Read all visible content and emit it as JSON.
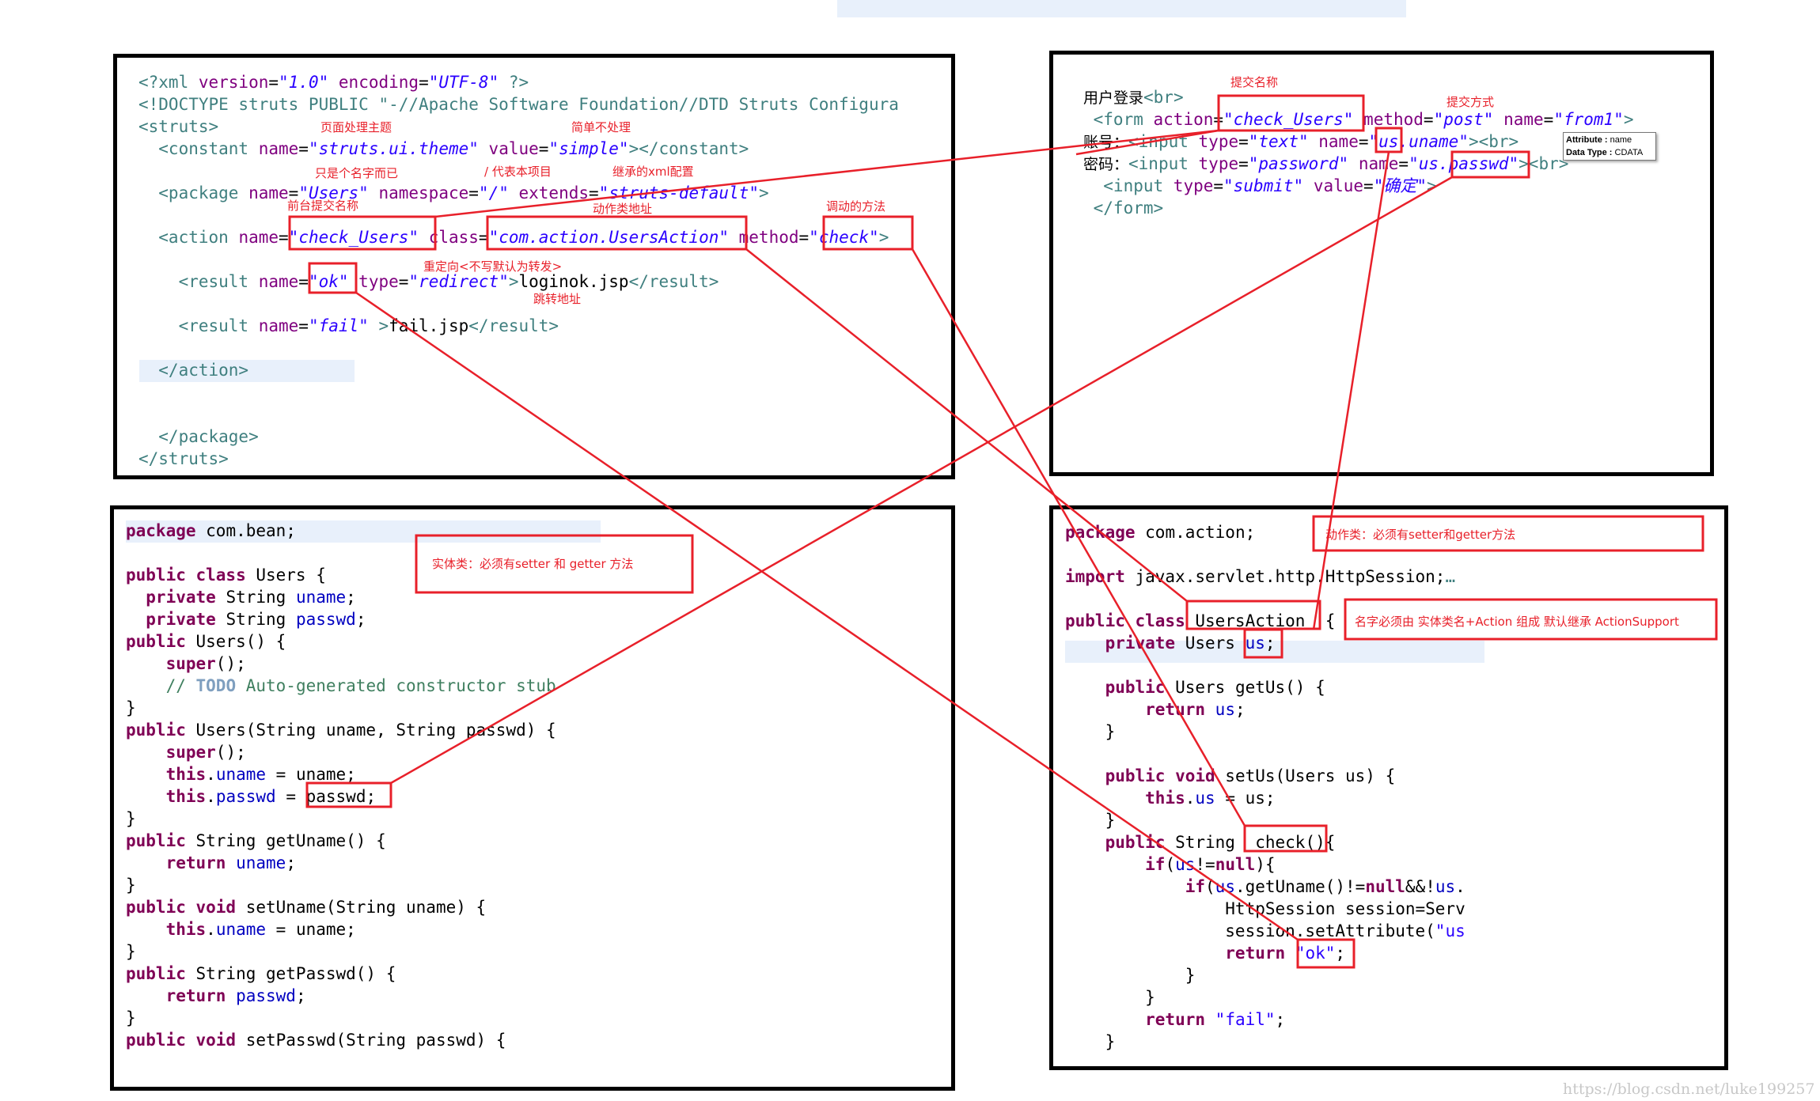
{
  "panels": {
    "struts_xml": {
      "lines": [
        [
          [
            "<?xml ",
            "t"
          ],
          [
            "version",
            "a"
          ],
          [
            "=",
            "p"
          ],
          [
            "\"1.0\"",
            "v"
          ],
          [
            " ",
            "p"
          ],
          [
            "encoding",
            "a"
          ],
          [
            "=",
            "p"
          ],
          [
            "\"UTF-8\"",
            "v"
          ],
          [
            " ?>",
            "t"
          ]
        ],
        [
          [
            "<!DOCTYPE struts PUBLIC ",
            "t"
          ],
          [
            "\"-//Apache Software Foundation//DTD Struts Configura",
            "t"
          ]
        ],
        [
          [
            "<struts>",
            "t"
          ]
        ],
        [
          [
            "  <constant ",
            "t"
          ],
          [
            "name",
            "a"
          ],
          [
            "=",
            "p"
          ],
          [
            "\"struts.ui.theme\"",
            "v"
          ],
          [
            " ",
            "p"
          ],
          [
            "value",
            "a"
          ],
          [
            "=",
            "p"
          ],
          [
            "\"simple\"",
            "v"
          ],
          [
            "></constant>",
            "t"
          ]
        ],
        [],
        [
          [
            "  <package ",
            "t"
          ],
          [
            "name",
            "a"
          ],
          [
            "=",
            "p"
          ],
          [
            "\"Users\"",
            "v"
          ],
          [
            " namespace",
            "a"
          ],
          [
            "=",
            "p"
          ],
          [
            "\"/\"",
            "v"
          ],
          [
            " extends",
            "a"
          ],
          [
            "=",
            "p"
          ],
          [
            "\"struts-default\"",
            "v"
          ],
          [
            ">",
            "t"
          ]
        ],
        [],
        [
          [
            "  <action ",
            "t"
          ],
          [
            "name",
            "a"
          ],
          [
            "=",
            "p"
          ],
          [
            "\"check_Users\"",
            "v"
          ],
          [
            " class",
            "a"
          ],
          [
            "=",
            "p"
          ],
          [
            "\"com.action.UsersAction\"",
            "v"
          ],
          [
            " method",
            "a"
          ],
          [
            "=",
            "p"
          ],
          [
            "\"check\"",
            "v"
          ],
          [
            ">",
            "t"
          ]
        ],
        [],
        [
          [
            "    <result ",
            "t"
          ],
          [
            "name",
            "a"
          ],
          [
            "=",
            "p"
          ],
          [
            "\"ok\"",
            "v"
          ],
          [
            " type",
            "a"
          ],
          [
            "=",
            "p"
          ],
          [
            "\"redirect\"",
            "v"
          ],
          [
            ">",
            "t"
          ],
          [
            "loginok.jsp",
            "p"
          ],
          [
            "</result>",
            "t"
          ]
        ],
        [],
        [
          [
            "    <result ",
            "t"
          ],
          [
            "name",
            "a"
          ],
          [
            "=",
            "p"
          ],
          [
            "\"fail\"",
            "v"
          ],
          [
            " >",
            "t"
          ],
          [
            "fail.jsp",
            "p"
          ],
          [
            "</result>",
            "t"
          ]
        ],
        [],
        [
          [
            "  </action>",
            "t"
          ]
        ],
        [],
        [],
        [
          [
            "  </package>",
            "t"
          ]
        ],
        [
          [
            "</struts>",
            "t"
          ]
        ]
      ],
      "notes": {
        "theme": "页面处理主题",
        "simple": "简单不处理",
        "name_only": "只是个名字而已",
        "namespace": "/ 代表本项目",
        "extends": "继承的xml配置",
        "action_name": "前台提交名称",
        "class_addr": "动作类地址",
        "method": "调动的方法",
        "redirect": "重定向<不写默认为转发>",
        "jump": "跳转地址"
      }
    },
    "jsp_form": {
      "lines": [
        [
          [
            "用户登录",
            "p cn"
          ],
          [
            "<br>",
            "t"
          ]
        ],
        [
          [
            " <form ",
            "t"
          ],
          [
            "action",
            "a"
          ],
          [
            "=",
            "p"
          ],
          [
            "\"check_Users\"",
            "v"
          ],
          [
            " method",
            "a"
          ],
          [
            "=",
            "p"
          ],
          [
            "\"post\"",
            "v"
          ],
          [
            " name",
            "a"
          ],
          [
            "=",
            "p"
          ],
          [
            "\"from1\"",
            "v"
          ],
          [
            ">",
            "t"
          ]
        ],
        [
          [
            "账号：",
            "p cn"
          ],
          [
            "<input ",
            "t"
          ],
          [
            "type",
            "a"
          ],
          [
            "=",
            "p"
          ],
          [
            "\"text\"",
            "v"
          ],
          [
            " name",
            "a"
          ],
          [
            "=",
            "p"
          ],
          [
            "\"us.uname\"",
            "v"
          ],
          [
            "><br>",
            "t"
          ]
        ],
        [
          [
            "密码：",
            "p cn"
          ],
          [
            "<input ",
            "t"
          ],
          [
            "type",
            "a"
          ],
          [
            "=",
            "p"
          ],
          [
            "\"password\"",
            "v"
          ],
          [
            " name",
            "a"
          ],
          [
            "=",
            "p"
          ],
          [
            "\"us.passwd\"",
            "v"
          ],
          [
            "><br>",
            "t"
          ]
        ],
        [
          [
            "  <input ",
            "t"
          ],
          [
            "type",
            "a"
          ],
          [
            "=",
            "p"
          ],
          [
            "\"submit\"",
            "v"
          ],
          [
            " value",
            "a"
          ],
          [
            "=",
            "p"
          ],
          [
            "\"确定\"",
            "v"
          ],
          [
            ">",
            "t"
          ]
        ],
        [
          [
            " </form>",
            "t"
          ]
        ]
      ],
      "notes": {
        "submit_name": "提交名称",
        "submit_method": "提交方式"
      },
      "tooltip": {
        "attribute_label": "Attribute : ",
        "attribute_value": "name",
        "type_label": "Data Type : ",
        "type_value": "CDATA"
      }
    },
    "users_bean": {
      "lines": [
        [
          [
            "package",
            "k"
          ],
          [
            " com.bean;",
            "p"
          ]
        ],
        [],
        [
          [
            "public class",
            "k"
          ],
          [
            " Users {",
            "p"
          ]
        ],
        [
          [
            "  private",
            "k"
          ],
          [
            " String ",
            "p"
          ],
          [
            "uname",
            "f"
          ],
          [
            ";",
            "p"
          ]
        ],
        [
          [
            "  private",
            "k"
          ],
          [
            " String ",
            "p"
          ],
          [
            "passwd",
            "f"
          ],
          [
            ";",
            "p"
          ]
        ],
        [
          [
            "public",
            "k"
          ],
          [
            " Users() {",
            "p"
          ]
        ],
        [
          [
            "    super",
            "k"
          ],
          [
            "();",
            "p"
          ]
        ],
        [
          [
            "    // ",
            "c"
          ],
          [
            "TODO",
            "d"
          ],
          [
            " Auto-generated constructor stub",
            "c"
          ]
        ],
        [
          [
            "}",
            "p"
          ]
        ],
        [
          [
            "public",
            "k"
          ],
          [
            " Users(String uname, String passwd) {",
            "p"
          ]
        ],
        [
          [
            "    super",
            "k"
          ],
          [
            "();",
            "p"
          ]
        ],
        [
          [
            "    this",
            "k"
          ],
          [
            ".",
            "p"
          ],
          [
            "uname",
            "f"
          ],
          [
            " = uname;",
            "p"
          ]
        ],
        [
          [
            "    this",
            "k"
          ],
          [
            ".",
            "p"
          ],
          [
            "passwd",
            "f"
          ],
          [
            " = passwd;",
            "p"
          ]
        ],
        [
          [
            "}",
            "p"
          ]
        ],
        [
          [
            "public",
            "k"
          ],
          [
            " String getUname() {",
            "p"
          ]
        ],
        [
          [
            "    return",
            "k"
          ],
          [
            " ",
            "p"
          ],
          [
            "uname",
            "f"
          ],
          [
            ";",
            "p"
          ]
        ],
        [
          [
            "}",
            "p"
          ]
        ],
        [
          [
            "public void",
            "k"
          ],
          [
            " setUname(String uname) {",
            "p"
          ]
        ],
        [
          [
            "    this",
            "k"
          ],
          [
            ".",
            "p"
          ],
          [
            "uname",
            "f"
          ],
          [
            " = uname;",
            "p"
          ]
        ],
        [
          [
            "}",
            "p"
          ]
        ],
        [
          [
            "public",
            "k"
          ],
          [
            " String getPasswd() {",
            "p"
          ]
        ],
        [
          [
            "    return",
            "k"
          ],
          [
            " ",
            "p"
          ],
          [
            "passwd",
            "f"
          ],
          [
            ";",
            "p"
          ]
        ],
        [
          [
            "}",
            "p"
          ]
        ],
        [
          [
            "public void",
            "k"
          ],
          [
            " setPasswd(String passwd) {",
            "p"
          ]
        ]
      ],
      "note": "实体类：必须有setter 和 getter 方法"
    },
    "users_action": {
      "lines": [
        [
          [
            "package",
            "k"
          ],
          [
            " com.action;",
            "p"
          ]
        ],
        [],
        [
          [
            "import",
            "k"
          ],
          [
            " javax.servlet.http.HttpSession;",
            "p"
          ],
          [
            "…",
            "t"
          ]
        ],
        [],
        [
          [
            "public class",
            "k"
          ],
          [
            " UsersAction  {",
            "p"
          ]
        ],
        [
          [
            "    private",
            "k"
          ],
          [
            " Users ",
            "p"
          ],
          [
            "us",
            "f"
          ],
          [
            ";",
            "p"
          ]
        ],
        [],
        [
          [
            "    public",
            "k"
          ],
          [
            " Users getUs() {",
            "p"
          ]
        ],
        [
          [
            "        return",
            "k"
          ],
          [
            " ",
            "p"
          ],
          [
            "us",
            "f"
          ],
          [
            ";",
            "p"
          ]
        ],
        [
          [
            "    }",
            "p"
          ]
        ],
        [],
        [
          [
            "    public void",
            "k"
          ],
          [
            " setUs(Users us) {",
            "p"
          ]
        ],
        [
          [
            "        this",
            "k"
          ],
          [
            ".",
            "p"
          ],
          [
            "us",
            "f"
          ],
          [
            " = us;",
            "p"
          ]
        ],
        [
          [
            "    }",
            "p"
          ]
        ],
        [
          [
            "    public",
            "k"
          ],
          [
            " String  check(){",
            "p"
          ]
        ],
        [
          [
            "        if",
            "k"
          ],
          [
            "(",
            "p"
          ],
          [
            "us",
            "f"
          ],
          [
            "!=",
            "p"
          ],
          [
            "null",
            "k"
          ],
          [
            "){",
            "p"
          ]
        ],
        [
          [
            "            if",
            "k"
          ],
          [
            "(",
            "p"
          ],
          [
            "us",
            "f"
          ],
          [
            ".getUname()!=",
            "p"
          ],
          [
            "null",
            "k"
          ],
          [
            "&&!",
            "p"
          ],
          [
            "us",
            "f"
          ],
          [
            ".",
            "p"
          ]
        ],
        [
          [
            "                HttpSession session=Serv",
            "p"
          ]
        ],
        [
          [
            "                session.setAttribute(",
            "p"
          ],
          [
            "\"us",
            "s"
          ]
        ],
        [
          [
            "                return",
            "k"
          ],
          [
            " ",
            "p"
          ],
          [
            "\"ok\"",
            "s"
          ],
          [
            ";",
            "p"
          ]
        ],
        [
          [
            "            }",
            "p"
          ]
        ],
        [
          [
            "        }",
            "p"
          ]
        ],
        [
          [
            "        return",
            "k"
          ],
          [
            " ",
            "p"
          ],
          [
            "\"fail\"",
            "s"
          ],
          [
            ";",
            "p"
          ]
        ],
        [
          [
            "    }",
            "p"
          ]
        ]
      ],
      "note_action": "动作类：必须有setter和getter方法",
      "note_naming": "名字必须由 实体类名+Action 组成    默认继承 ActionSupport"
    }
  },
  "watermark": "https://blog.csdn.net/luke199257",
  "colors": {
    "annotation": "#e8202a",
    "tag": "#3f7f7f",
    "attribute": "#7f007f",
    "value": "#2a00ff",
    "keyword": "#7f0055"
  }
}
